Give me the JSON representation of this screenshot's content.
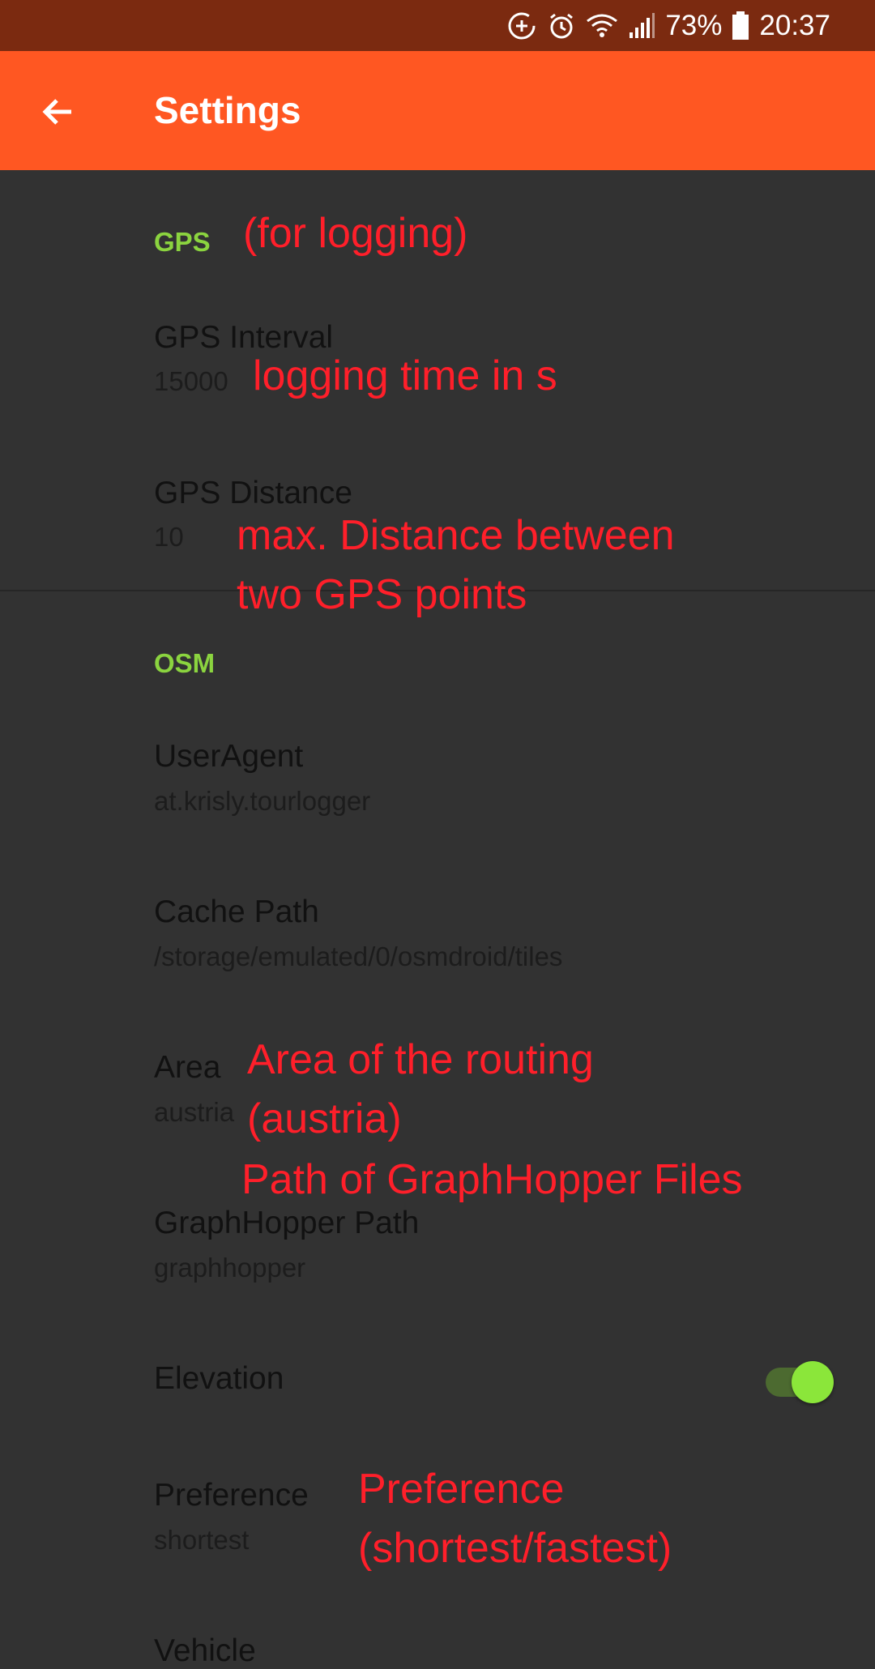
{
  "status_bar": {
    "battery_percent": "73%",
    "time": "20:37",
    "icons": [
      "data-saver-icon",
      "alarm-icon",
      "wifi-icon",
      "signal-icon",
      "battery-icon"
    ]
  },
  "app_bar": {
    "back_icon": "arrow-back-icon",
    "title": "Settings",
    "color": "#ff5722"
  },
  "categories": {
    "gps": {
      "title": "GPS",
      "prefs": {
        "interval": {
          "title": "GPS Interval",
          "summary": "15000"
        },
        "distance": {
          "title": "GPS Distance",
          "summary": "10"
        }
      }
    },
    "osm": {
      "title": "OSM",
      "prefs": {
        "user_agent": {
          "title": "UserAgent",
          "summary": "at.krisly.tourlogger"
        },
        "cache_path": {
          "title": "Cache Path",
          "summary": "/storage/emulated/0/osmdroid/tiles"
        },
        "area": {
          "title": "Area",
          "summary": "austria"
        },
        "graphhopper_path": {
          "title": "GraphHopper Path",
          "summary": "graphhopper"
        },
        "elevation": {
          "title": "Elevation",
          "enabled": true
        },
        "preference": {
          "title": "Preference",
          "summary": "shortest"
        },
        "vehicle": {
          "title": "Vehicle"
        }
      }
    }
  },
  "annotations": {
    "gps_category": "(for logging)",
    "gps_interval": "logging time in s",
    "gps_distance_line1": "max. Distance between",
    "gps_distance_line2": "two GPS points",
    "area_line1": "Area of the routing",
    "area_line2": "(austria)",
    "graphhopper": "Path of GraphHopper Files",
    "preference_line1": "Preference",
    "preference_line2": "(shortest/fastest)"
  },
  "colors": {
    "accent": "#8bd43f",
    "annotation": "#ff1f2a",
    "background": "#323232"
  }
}
